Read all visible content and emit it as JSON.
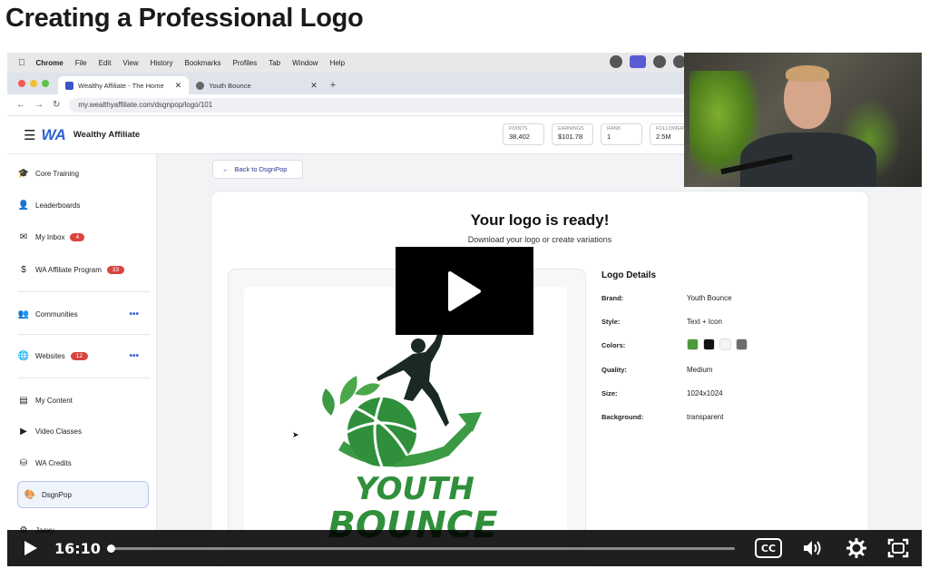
{
  "page": {
    "title": "Creating a Professional Logo"
  },
  "menubar": {
    "items": [
      "Chrome",
      "File",
      "Edit",
      "View",
      "History",
      "Bookmarks",
      "Profiles",
      "Tab",
      "Window",
      "Help"
    ]
  },
  "browser": {
    "tabs": [
      {
        "label": "Wealthy Affiliate - The Home",
        "active": true
      },
      {
        "label": "Youth Bounce",
        "active": false
      }
    ],
    "url": "my.wealthyaffiliate.com/dsgnpop/logo/101"
  },
  "site": {
    "brand": "Wealthy Affiliate",
    "logo_text": "WA",
    "stats": [
      {
        "label": "POINTS",
        "value": "38,402"
      },
      {
        "label": "EARNINGS",
        "value": "$101.78"
      },
      {
        "label": "RANK",
        "value": "1"
      },
      {
        "label": "FOLLOWERS",
        "value": "2.5M"
      }
    ]
  },
  "sidebar": {
    "items": [
      {
        "label": "Core Training",
        "icon": "graduation-cap-icon"
      },
      {
        "label": "Leaderboards",
        "icon": "user-icon"
      },
      {
        "label": "My Inbox",
        "icon": "mail-icon",
        "badge": "4"
      },
      {
        "label": "WA Affiliate Program",
        "icon": "dollar-icon",
        "badge": "33"
      },
      {
        "label": "Communities",
        "icon": "people-icon",
        "dots": "•••"
      },
      {
        "label": "Websites",
        "icon": "globe-icon",
        "badge": "12",
        "dots": "•••"
      },
      {
        "label": "My Content",
        "icon": "document-icon"
      },
      {
        "label": "Video Classes",
        "icon": "video-icon"
      },
      {
        "label": "WA Credits",
        "icon": "credits-icon"
      },
      {
        "label": "DsgnPop",
        "icon": "palette-icon",
        "active": true
      },
      {
        "label": "Jaaxy",
        "icon": "jaaxy-icon"
      }
    ]
  },
  "main": {
    "back_label": "Back to DsgnPop",
    "heading": "Your logo is ready!",
    "subheading": "Download your logo or create variations",
    "logo_text_line1": "YOUTH",
    "logo_text_line2": "BOUNCE",
    "details": {
      "title": "Logo Details",
      "rows": [
        {
          "key": "Brand:",
          "value": "Youth Bounce"
        },
        {
          "key": "Style:",
          "value": "Text + Icon"
        },
        {
          "key": "Colors:",
          "value": ""
        },
        {
          "key": "Quality:",
          "value": "Medium"
        },
        {
          "key": "Size:",
          "value": "1024x1024"
        },
        {
          "key": "Background:",
          "value": "transparent"
        }
      ],
      "colors": [
        "#4a9a3c",
        "#111111",
        "#f4f4f4",
        "#6e6e6e"
      ]
    }
  },
  "player": {
    "time": "16:10",
    "cc_label": "CC",
    "progress": 0.0
  }
}
